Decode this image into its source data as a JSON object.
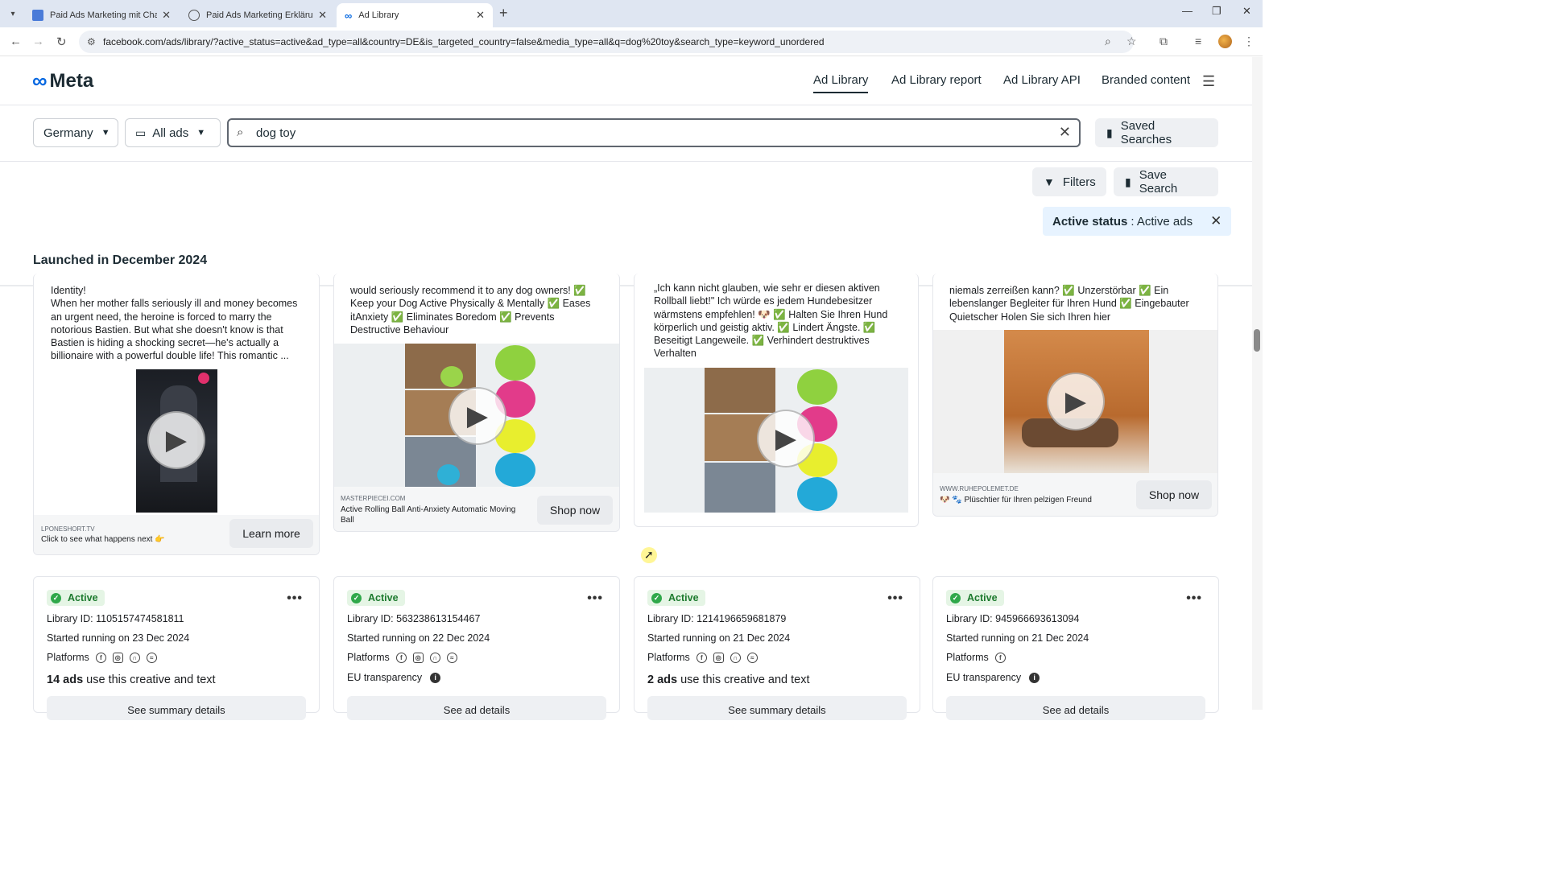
{
  "browser": {
    "tabs": [
      {
        "title": "Paid Ads Marketing mit ChatGPT",
        "active": false,
        "icon": "doc-icon"
      },
      {
        "title": "Paid Ads Marketing Erklärung",
        "active": false,
        "icon": "globe-icon"
      },
      {
        "title": "Ad Library",
        "active": true,
        "icon": "meta-icon"
      }
    ],
    "url": "facebook.com/ads/library/?active_status=active&ad_type=all&country=DE&is_targeted_country=false&media_type=all&q=dog%20toy&search_type=keyword_unordered"
  },
  "header": {
    "logo_text": "Meta",
    "nav": [
      "Ad Library",
      "Ad Library report",
      "Ad Library API",
      "Branded content"
    ],
    "active_nav": "Ad Library"
  },
  "controls": {
    "country": "Germany",
    "ad_type": "All ads",
    "search_value": "dog toy",
    "saved_searches": "Saved Searches",
    "filters": "Filters",
    "save_search": "Save Search"
  },
  "active_filter": {
    "label": "Active status",
    "value": ": Active ads"
  },
  "section_title": "Launched in December 2024",
  "ads": [
    {
      "text": "Identity!\nWhen her mother falls seriously ill and money becomes an urgent need, the heroine is forced to marry the notorious Bastien. But what she doesn't know is that Bastien is hiding a shocking secret—he's actually a billionaire with a powerful double life! This romantic ...",
      "domain": "LPONESHORT.TV",
      "footer_text": "Click to see what happens next 👉",
      "cta": "Learn more"
    },
    {
      "text": "would seriously recommend it to any dog owners! ✅ Keep your Dog Active Physically & Mentally ✅ Eases itAnxiety ✅ Eliminates Boredom ✅ Prevents Destructive Behaviour",
      "domain": "MASTERPIECEI.COM",
      "footer_text": "Active Rolling Ball Anti-Anxiety Automatic Moving Ball",
      "cta": "Shop now"
    },
    {
      "text": "„Ich kann nicht glauben, wie sehr er diesen aktiven Rollball liebt!\" Ich würde es jedem Hundebesitzer wärmstens empfehlen! 🐶 ✅ Halten Sie Ihren Hund körperlich und geistig aktiv. ✅ Lindert Ängste. ✅ Beseitigt Langeweile. ✅ Verhindert destruktives Verhalten",
      "domain": "",
      "footer_text": "",
      "cta": ""
    },
    {
      "text": "niemals zerreißen kann? ✅ Unzerstörbar ✅ Ein lebenslanger Begleiter für Ihren Hund ✅ Eingebauter Quietscher Holen Sie sich Ihren hier",
      "domain": "WWW.RUHEPOLEMET.DE",
      "footer_text": "🐶 🐾 Plüschtier für Ihren pelzigen Freund",
      "cta": "Shop now"
    }
  ],
  "listings": [
    {
      "status": "Active",
      "library_id": "Library ID: 1105157474581811",
      "started": "Started running on 23 Dec 2024",
      "platforms_label": "Platforms",
      "platforms": [
        "facebook-icon",
        "instagram-icon",
        "audience-network-icon",
        "messenger-icon"
      ],
      "count_bold": "14 ads",
      "count_rest": " use this creative and text",
      "eu": "",
      "details": "See summary details"
    },
    {
      "status": "Active",
      "library_id": "Library ID: 563238613154467",
      "started": "Started running on 22 Dec 2024",
      "platforms_label": "Platforms",
      "platforms": [
        "facebook-icon",
        "instagram-icon",
        "audience-network-icon",
        "messenger-icon"
      ],
      "count_bold": "",
      "count_rest": "",
      "eu": "EU transparency",
      "details": "See ad details"
    },
    {
      "status": "Active",
      "library_id": "Library ID: 1214196659681879",
      "started": "Started running on 21 Dec 2024",
      "platforms_label": "Platforms",
      "platforms": [
        "facebook-icon",
        "instagram-icon",
        "audience-network-icon",
        "messenger-icon"
      ],
      "count_bold": "2 ads",
      "count_rest": " use this creative and text",
      "eu": "",
      "details": "See summary details"
    },
    {
      "status": "Active",
      "library_id": "Library ID: 945966693613094",
      "started": "Started running on 21 Dec 2024",
      "platforms_label": "Platforms",
      "platforms": [
        "facebook-icon"
      ],
      "count_bold": "",
      "count_rest": "",
      "eu": "EU transparency",
      "details": "See ad details"
    }
  ],
  "colors": {
    "meta_blue": "#0668e1",
    "active_green": "#2fa84a",
    "chip_bg": "#e7f3ff"
  }
}
